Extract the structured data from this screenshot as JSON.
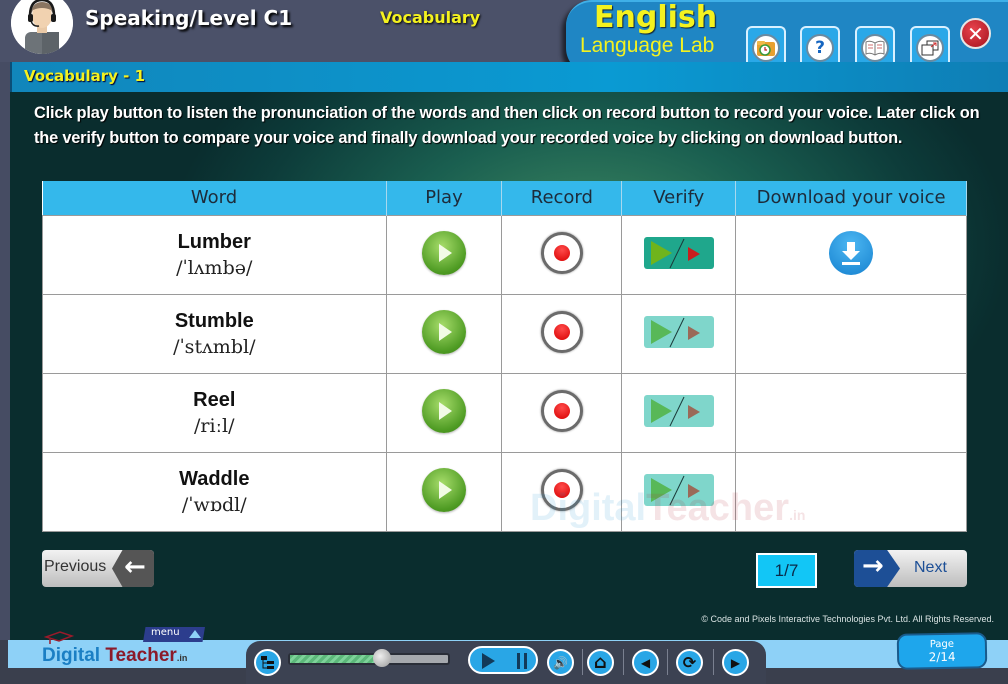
{
  "header": {
    "level_title": "Speaking/Level C1",
    "section_title": "Vocabulary",
    "brand_line1": "English",
    "brand_line2": "Language Lab",
    "tabs": [
      {
        "icon": "folder-clock-icon",
        "glyph": "🕒"
      },
      {
        "icon": "help-icon",
        "glyph": "?"
      },
      {
        "icon": "book-icon",
        "glyph": "📖"
      },
      {
        "icon": "window-restore-icon",
        "glyph": "⧉"
      }
    ],
    "close_glyph": "✕"
  },
  "subheader": {
    "title": "Vocabulary - 1"
  },
  "instructions": "Click play button to listen the pronunciation of the words and then click on record button to record your voice. Later click on the verify button to compare your voice and finally download your recorded voice by clicking on download button.",
  "table": {
    "columns": [
      "Word",
      "Play",
      "Record",
      "Verify",
      "Download your voice"
    ],
    "rows": [
      {
        "word": "Lumber",
        "ipa": "/ˈlʌmbə/",
        "verify_active": true,
        "download_available": true
      },
      {
        "word": "Stumble",
        "ipa": "/ˈstʌmbl/",
        "verify_active": false,
        "download_available": false
      },
      {
        "word": "Reel",
        "ipa": "/riːl/",
        "verify_active": false,
        "download_available": false
      },
      {
        "word": "Waddle",
        "ipa": "/ˈwɒdl/",
        "verify_active": false,
        "download_available": false
      }
    ]
  },
  "watermark": {
    "part1": "Digital",
    "part2": "Teacher",
    "suffix": ".in"
  },
  "navigation": {
    "previous_label": "Previous",
    "next_label": "Next",
    "arrow_left": "🡐",
    "arrow_right": "🡒",
    "page_counter": "1/7"
  },
  "copyright": "© Code and Pixels Interactive Technologies  Pvt. Ltd. All Rights Reserved.",
  "footer": {
    "menu_label": "menu",
    "logo_part1": "Digital",
    "logo_part2": "Teacher",
    "logo_suffix": ".in",
    "progress": 0.58,
    "page_label": "Page",
    "page_value": "2/14",
    "controls": {
      "volume_glyph": "🔊",
      "home_glyph": "⌂",
      "prev_glyph": "◀",
      "refresh_glyph": "⟳",
      "next_glyph": "▶"
    }
  }
}
